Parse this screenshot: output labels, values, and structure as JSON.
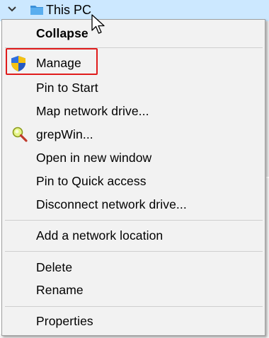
{
  "tree": {
    "label": "This PC",
    "chevron_icon": "chevron-down-icon",
    "folder_icon": "computer-folder-icon"
  },
  "menu": {
    "items": [
      {
        "label": "Collapse",
        "bold": true,
        "icon": ""
      },
      {
        "label": "Manage",
        "bold": false,
        "icon": "uac-shield-icon"
      },
      {
        "label": "Pin to Start",
        "bold": false,
        "icon": ""
      },
      {
        "label": "Map network drive...",
        "bold": false,
        "icon": ""
      },
      {
        "label": "grepWin...",
        "bold": false,
        "icon": "magnifier-icon"
      },
      {
        "label": "Open in new window",
        "bold": false,
        "icon": ""
      },
      {
        "label": "Pin to Quick access",
        "bold": false,
        "icon": ""
      },
      {
        "label": "Disconnect network drive...",
        "bold": false,
        "icon": ""
      },
      {
        "label": "Add a network location",
        "bold": false,
        "icon": ""
      },
      {
        "label": "Delete",
        "bold": false,
        "icon": ""
      },
      {
        "label": "Rename",
        "bold": false,
        "icon": ""
      },
      {
        "label": "Properties",
        "bold": false,
        "icon": ""
      }
    ],
    "highlighted_item": "Manage"
  },
  "colors": {
    "selection_bg": "#cce8ff",
    "menu_bg": "#f2f2f2",
    "highlight_border": "#e01b1b"
  }
}
